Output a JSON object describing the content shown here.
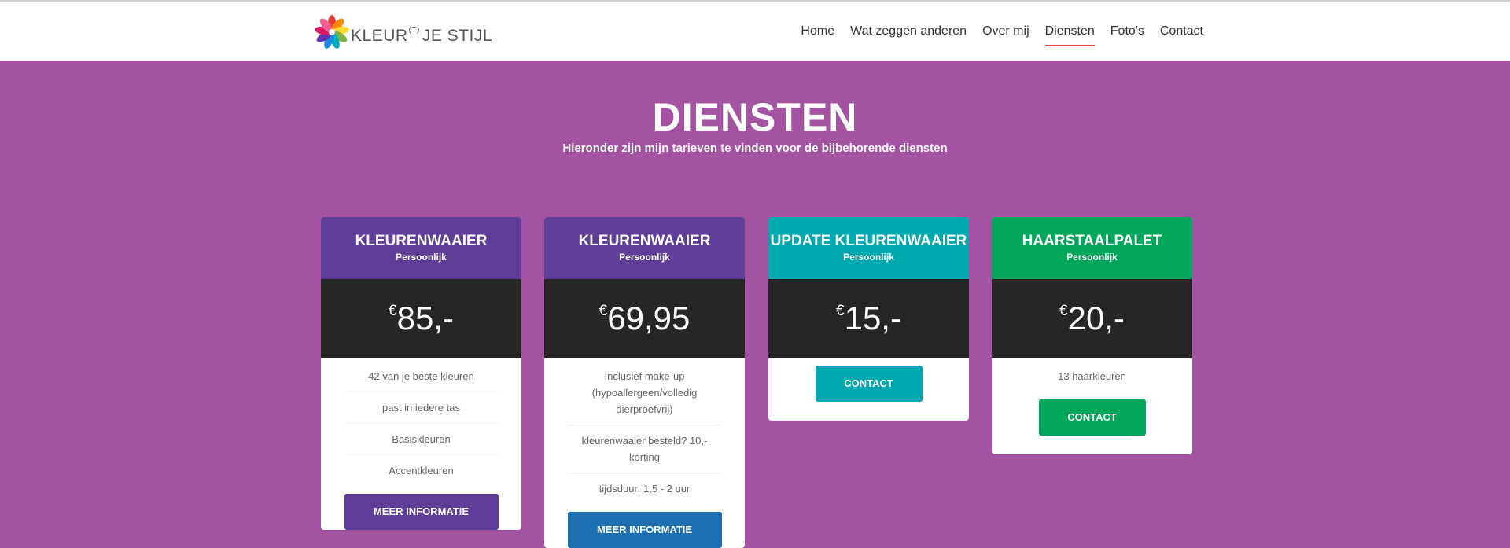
{
  "header": {
    "logo": {
      "text": "KLEUR",
      "sup": "(T)",
      "text2": "JE STIJL"
    },
    "nav": [
      {
        "label": "Home"
      },
      {
        "label": "Wat zeggen anderen"
      },
      {
        "label": "Over mij"
      },
      {
        "label": "Diensten",
        "active": true
      },
      {
        "label": "Foto's"
      },
      {
        "label": "Contact"
      }
    ]
  },
  "main": {
    "title": "DIENSTEN",
    "subtitle": "Hieronder zijn mijn tarieven te vinden voor de bijbehorende diensten"
  },
  "cards": [
    {
      "title": "KLEURENWAAIER",
      "subtitle": "Persoonlijk",
      "currency": "€",
      "price": "85,-",
      "head_color": "#5e3e98",
      "features": [
        "42 van je beste kleuren",
        "past in iedere tas",
        "Basiskleuren",
        "Accentkleuren"
      ],
      "button": "MEER INFORMATIE",
      "button_color": "#5e3e98"
    },
    {
      "title": "KLEURENWAAIER",
      "subtitle": "Persoonlijk",
      "currency": "€",
      "price": "69,95",
      "head_color": "#5e3e98",
      "features": [
        "Inclusief make-up (hypoallergeen/volledig dierproefvrij)",
        "kleurenwaaier besteld? 10,- korting",
        "tijdsduur: 1,5 - 2 uur"
      ],
      "button": "MEER INFORMATIE",
      "button_color": "#1c6fb1"
    },
    {
      "title": "UPDATE KLEURENWAAIER",
      "subtitle": "Persoonlijk",
      "currency": "€",
      "price": "15,-",
      "head_color": "#00a8b0",
      "features": [],
      "button": "CONTACT",
      "button_color": "#00a8b0"
    },
    {
      "title": "HAARSTAALPALET",
      "subtitle": "Persoonlijk",
      "currency": "€",
      "price": "20,-",
      "head_color": "#00a65a",
      "features": [
        "13 haarkleuren"
      ],
      "button": "CONTACT",
      "button_color": "#00a65a"
    }
  ],
  "colors": {
    "background": "#a453a2",
    "nav_active_underline": "#e0493e",
    "price_band": "#262626"
  }
}
